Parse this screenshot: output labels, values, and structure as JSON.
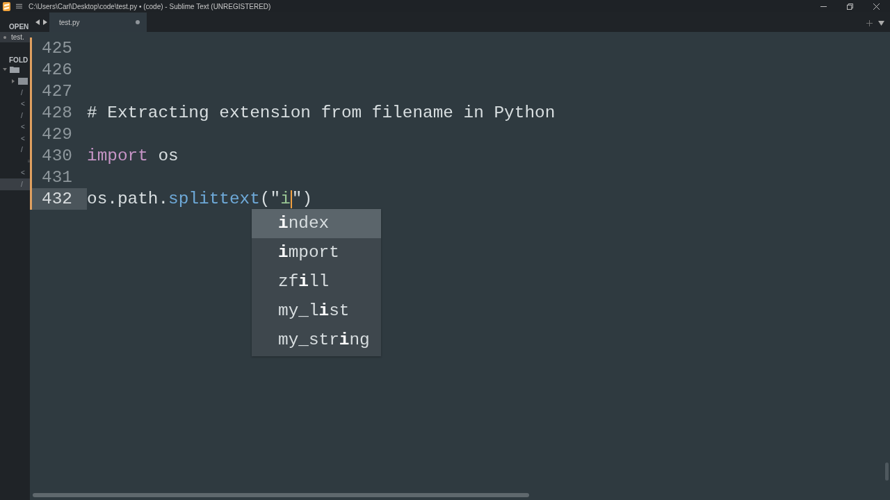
{
  "window": {
    "title": "C:\\Users\\Carl\\Desktop\\code\\test.py • (code) - Sublime Text (UNREGISTERED)"
  },
  "sidebar": {
    "open_files_heading": "OPEN",
    "open_files": [
      {
        "name": "test.",
        "selected": true
      }
    ],
    "folders_heading": "FOLD",
    "tree": [
      {
        "kind": "folder",
        "expanded": true,
        "children": [
          {
            "kind": "folder",
            "expanded": false
          },
          {
            "kind": "file",
            "name": "/",
            "selected": false
          },
          {
            "kind": "file",
            "name": "<",
            "selected": false
          },
          {
            "kind": "file",
            "name": "/",
            "selected": false
          },
          {
            "kind": "file",
            "name": "<",
            "selected": false
          },
          {
            "kind": "file",
            "name": "<",
            "selected": false
          },
          {
            "kind": "file",
            "name": "/",
            "selected": false
          },
          {
            "kind": "image",
            "selected": false
          },
          {
            "kind": "file",
            "name": "<",
            "selected": false
          },
          {
            "kind": "file",
            "name": "/",
            "selected": true
          }
        ]
      }
    ]
  },
  "tabs": [
    {
      "label": "test.py",
      "selected": true,
      "dirty": true
    }
  ],
  "editor": {
    "lines": [
      {
        "number": "425",
        "modified": true,
        "active": false
      },
      {
        "number": "426",
        "modified": true,
        "active": false
      },
      {
        "number": "427",
        "modified": true,
        "active": false
      },
      {
        "number": "428",
        "modified": true,
        "active": false,
        "tokens": [
          {
            "kind": "comment",
            "text": "# Extracting extension from filename in Python"
          }
        ]
      },
      {
        "number": "429",
        "modified": true,
        "active": false
      },
      {
        "number": "430",
        "modified": true,
        "active": false,
        "tokens": [
          {
            "kind": "keyword",
            "text": "import"
          },
          {
            "kind": "plain",
            "text": " os"
          }
        ]
      },
      {
        "number": "431",
        "modified": true,
        "active": false
      },
      {
        "number": "432",
        "modified": true,
        "active": true,
        "tokens": [
          {
            "kind": "plain",
            "text": "os.path."
          },
          {
            "kind": "function",
            "text": "splittext"
          },
          {
            "kind": "plain",
            "text": "(\""
          },
          {
            "kind": "string",
            "text": "i",
            "caret_after": true
          },
          {
            "kind": "plain",
            "text": "\")"
          }
        ]
      }
    ],
    "completions": [
      {
        "label": "**i**ndex",
        "selected": true
      },
      {
        "label": "**i**mport",
        "selected": false
      },
      {
        "label": "zf**i**ll",
        "selected": false
      },
      {
        "label": "my_l**i**st",
        "selected": false
      },
      {
        "label": "my_str**i**ng",
        "selected": false
      }
    ]
  }
}
